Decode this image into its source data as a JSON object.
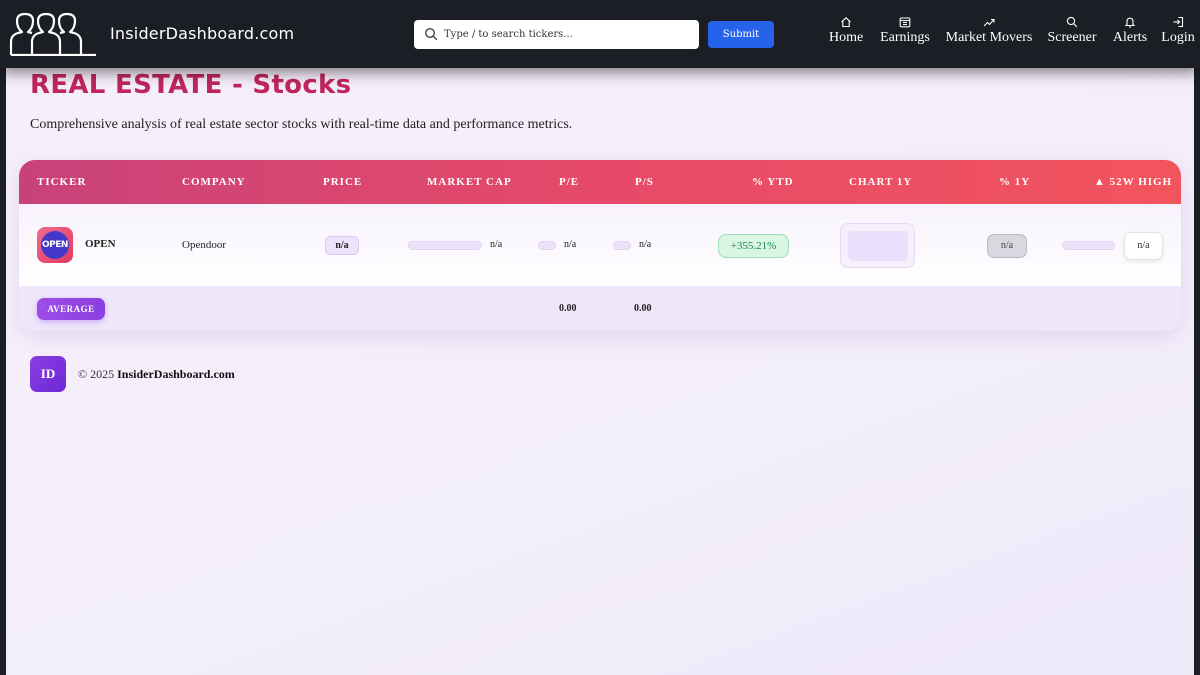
{
  "nav": {
    "brand": "InsiderDashboard.com",
    "search_placeholder": "Type / to search tickers...",
    "submit_label": "Submit",
    "items": [
      {
        "label": "Home",
        "icon": "home-icon"
      },
      {
        "label": "Earnings",
        "icon": "calendar-icon"
      },
      {
        "label": "Market Movers",
        "icon": "trending-up-icon"
      },
      {
        "label": "Screener",
        "icon": "search-icon"
      },
      {
        "label": "Alerts",
        "icon": "bell-icon"
      },
      {
        "label": "Login",
        "icon": "login-icon"
      }
    ]
  },
  "page": {
    "title": "REAL ESTATE - Stocks",
    "subtitle": "Comprehensive analysis of real estate sector stocks with real-time data and performance metrics."
  },
  "table": {
    "headers": [
      "TICKER",
      "COMPANY",
      "PRICE",
      "MARKET CAP",
      "P/E",
      "P/S",
      "% YTD",
      "CHART 1Y",
      "% 1Y",
      "▲ 52W HIGH"
    ],
    "rows": [
      {
        "logo_text": "OPEN",
        "ticker": "OPEN",
        "company": "Opendoor",
        "price": "n/a",
        "market_cap": "n/a",
        "pe": "n/a",
        "ps": "n/a",
        "ytd": "+355.21%",
        "pct_1y": "n/a",
        "high_52w": "n/a"
      }
    ],
    "average": {
      "label": "AVERAGE",
      "pe": "0.00",
      "ps": "0.00"
    }
  },
  "footer": {
    "logo_text": "ID",
    "copyright": "© 2025",
    "site": "InsiderDashboard.com"
  },
  "colors": {
    "title": "#c0265e",
    "header_gradient_start": "#c8427a",
    "header_gradient_end": "#f2545e",
    "submit": "#2563eb",
    "ytd_positive": "#1f8a4c",
    "average_badge": "#9d4de8"
  }
}
